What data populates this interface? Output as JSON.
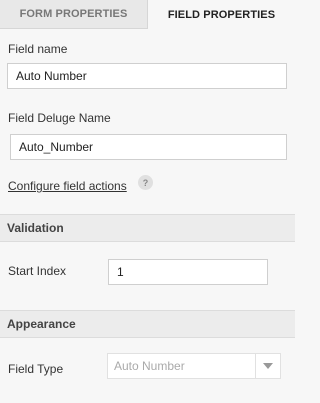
{
  "tabs": {
    "form_properties": "FORM PROPERTIES",
    "field_properties": "FIELD PROPERTIES"
  },
  "field": {
    "name_label": "Field name",
    "name_value": "Auto Number",
    "deluge_label": "Field Deluge Name",
    "deluge_value": "Auto_Number",
    "configure_link": "Configure field actions",
    "help_icon": "?"
  },
  "validation": {
    "title": "Validation",
    "start_index_label": "Start Index",
    "start_index_value": "1"
  },
  "appearance": {
    "title": "Appearance",
    "field_type_label": "Field Type",
    "field_type_value": "Auto Number"
  }
}
